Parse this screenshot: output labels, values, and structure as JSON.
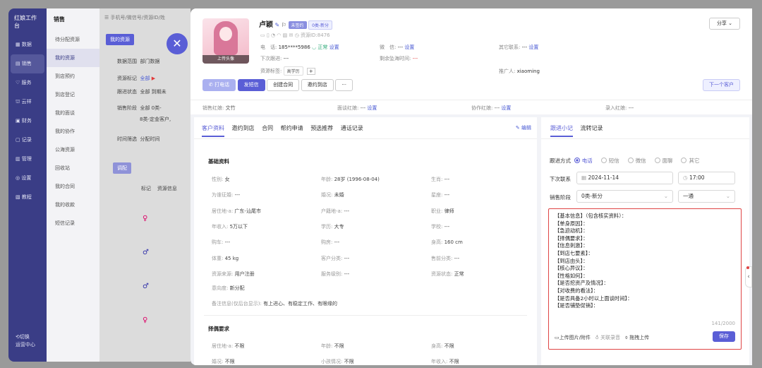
{
  "bgapp": {
    "brand": "红娘工作台",
    "nav": [
      {
        "icon": "grid-icon",
        "label": "数据"
      },
      {
        "icon": "sales-icon",
        "label": "销售"
      },
      {
        "icon": "heart-icon",
        "label": "服务"
      },
      {
        "icon": "cloud-icon",
        "label": "云祥"
      },
      {
        "icon": "money-icon",
        "label": "财务"
      },
      {
        "icon": "record-icon",
        "label": "记录"
      },
      {
        "icon": "manage-icon",
        "label": "管理"
      },
      {
        "icon": "settings-icon",
        "label": "设置"
      },
      {
        "icon": "tutorial-icon",
        "label": "教程"
      }
    ],
    "footer": "切换\n运营中心",
    "sub_title": "销售",
    "sub_items": [
      "待分配资源",
      "我的资源",
      "到店预约",
      "到店登记",
      "我的面谈",
      "我的协作",
      "公海资源",
      "回收站",
      "我的合同",
      "我的收款",
      "短信记录"
    ],
    "search_placeholder": "手机号/微信号/资源ID/姓",
    "my_resources_tab": "我的资源",
    "filters": [
      {
        "k": "数据范围",
        "v": "部门数据"
      },
      {
        "k": "资源标记",
        "v": "全部"
      },
      {
        "k": "跟进状态",
        "v": "全部   到期未"
      },
      {
        "k": "销售阶段",
        "v": "全部   0类-"
      },
      {
        "k": "",
        "v": "8类-定金客户,"
      },
      {
        "k": "时间筛选",
        "v": "分配时间"
      }
    ],
    "btn_transfer": "调配",
    "table_head": [
      "标记",
      "资源信息"
    ]
  },
  "drawer": {
    "name": "卢颖",
    "badge_type": "未签约",
    "badge_stage": "0类-新分",
    "resource_id_label": "资源ID:",
    "resource_id": "8476",
    "upload_avatar": "上传头像",
    "share": "分享",
    "phone_label": "电　话:",
    "phone": "185****5986",
    "phone_status": "正常",
    "set": "设置",
    "wechat_label": "微　信:",
    "wechat": "---",
    "other_label": "其它联系:",
    "other": "---",
    "next_label": "下次跟进:",
    "next": "---",
    "remain_label": "剩余坠海时间:",
    "remain": "---",
    "tags_label": "资源标签:",
    "tag": "高学历",
    "promoter_label": "推广人:",
    "promoter": "xiaoming",
    "actions": [
      "打电话",
      "发短信",
      "创建合同",
      "邀约到店",
      "···"
    ],
    "next_customer": "下一个客户",
    "sales_red_label": "销售红娘:",
    "sales_red": "文竹",
    "interview_red_label": "面谈红娘:",
    "interview_red": "---",
    "collab_red_label": "协作红娘:",
    "collab_red": "---",
    "entry_red_label": "录入红娘:",
    "entry_red": "---"
  },
  "profile": {
    "tabs": [
      "客户资料",
      "邀约到店",
      "合同",
      "帮约申请",
      "预选推荐",
      "通话记录"
    ],
    "edit": "编辑",
    "basic_title": "基础资料",
    "basic": [
      [
        "性别:",
        "女",
        "年龄:",
        "28岁 (1996-08-04)",
        "生肖:",
        "---"
      ],
      [
        "为谁征婚:",
        "---",
        "婚况:",
        "未婚",
        "星座:",
        "---"
      ],
      [
        "居住地-a:",
        "广东-汕尾市",
        "户籍地-a:",
        "---",
        "职业:",
        "律师"
      ],
      [
        "年收入:",
        "5万以下",
        "学历:",
        "大专",
        "学校:",
        "---"
      ],
      [
        "购车:",
        "---",
        "购房:",
        "---",
        "身高:",
        "160 cm"
      ],
      [
        "体重:",
        "45 kg",
        "客户分类:",
        "---",
        "售前分类:",
        "---"
      ],
      [
        "资源来源:",
        "用户注册",
        "服务级别:",
        "---",
        "资源状态:",
        "正常"
      ]
    ],
    "intent_label": "意向度:",
    "intent": "新分配",
    "remark_label": "备注信息(仅后台显示):",
    "remark": "有上进心、有稳定工作、有眼缘的",
    "spouse_title": "择偶要求",
    "spouse": [
      [
        "居住地-a:",
        "不限",
        "年龄:",
        "不限",
        "身高:",
        "不限"
      ],
      [
        "婚况:",
        "不限",
        "小孩情况:",
        "不限",
        "年收入:",
        "不限"
      ]
    ]
  },
  "follow": {
    "tabs": [
      "跟进小记",
      "流转记录"
    ],
    "method_label": "跟进方式",
    "methods": [
      "电话",
      "短信",
      "微信",
      "面聊",
      "其它"
    ],
    "next_label": "下次联系",
    "next_date": "2024-11-14",
    "next_time": "17:00",
    "stage_label": "销售阶段",
    "stage": "0类-新分",
    "level": "一通",
    "note": "【基本信息】（包含核实资料）：\n【单身原因】：\n【急迫动机】：\n【择偶要求】：\n【信息刺激】：\n【到店七要素】：\n【到店由头】：\n【核心异议】：\n【性格如何】：\n【是否挖资产及情况】：\n【对收费的看法】：\n【是否具备2小时以上面谈时间】：\n【是否铺垫促销】：",
    "counter": "141/2000",
    "upload": "上传图片/附件",
    "record": "关联录音",
    "drag": "拖拽上传",
    "save": "保存"
  }
}
